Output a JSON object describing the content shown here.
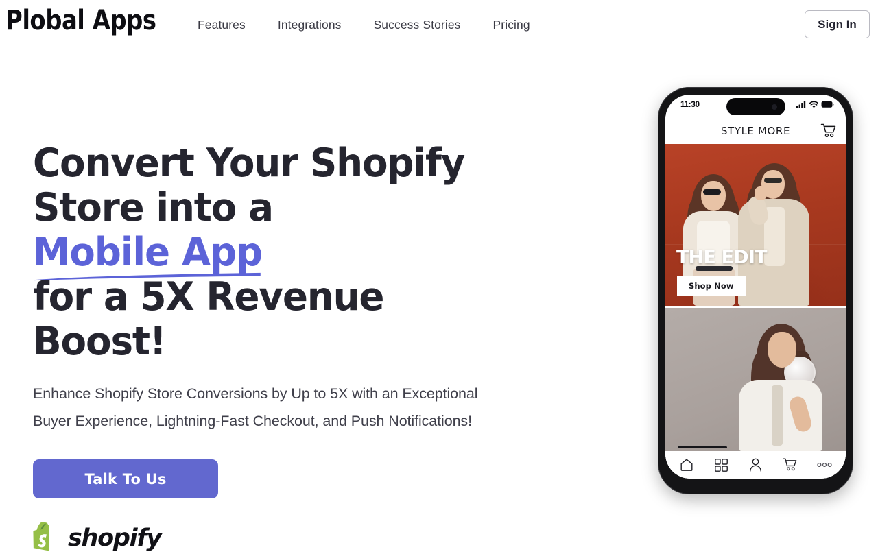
{
  "header": {
    "logo": "Plobal Apps",
    "nav": [
      {
        "label": "Features"
      },
      {
        "label": "Integrations"
      },
      {
        "label": "Success Stories"
      },
      {
        "label": "Pricing"
      }
    ],
    "sign_in_label": "Sign In"
  },
  "hero": {
    "headline_line1": "Convert Your Shopify",
    "headline_line2_before": "Store into a ",
    "headline_accent": "Mobile App",
    "headline_line3": "for a 5X Revenue Boost!",
    "subheadline": "Enhance Shopify Store Conversions by Up to 5X with an Exceptional Buyer Experience, Lightning-Fast Checkout, and Push Notifications!",
    "cta_label": "Talk To Us",
    "shopify_wordmark": "shopify"
  },
  "phone": {
    "status_time": "11:30",
    "app_title": "STYLE MORE",
    "hero_card": {
      "title": "THE EDIT",
      "button_label": "Shop Now"
    },
    "tabbar": [
      {
        "icon": "home-icon"
      },
      {
        "icon": "grid-icon"
      },
      {
        "icon": "person-icon"
      },
      {
        "icon": "cart-icon"
      },
      {
        "icon": "more-icon"
      }
    ],
    "status_icons": [
      "signal-icon",
      "wifi-icon",
      "battery-icon"
    ],
    "cart_icon": "cart-icon"
  },
  "colors": {
    "accent": "#5c63d8",
    "cta_bg": "#6268cf",
    "headline": "#25252f",
    "body_text": "#3f3f4a",
    "shopify_green": "#95bf47",
    "phone_frame": "#141416",
    "hero_card_bg": "#a8391f"
  }
}
